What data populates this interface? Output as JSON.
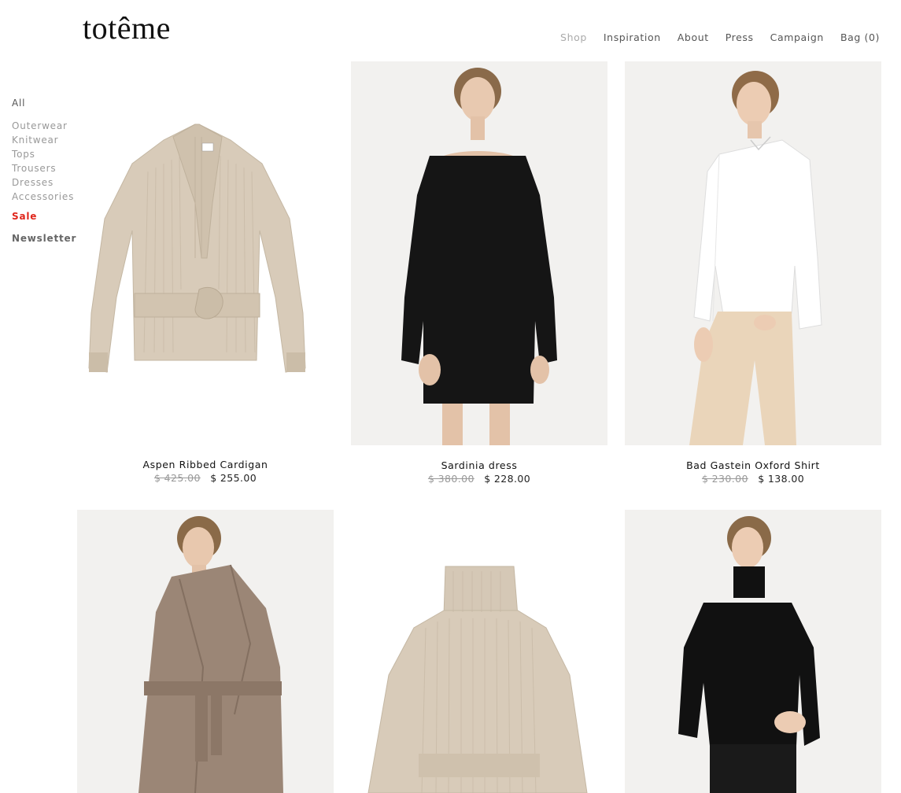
{
  "logo": "totême",
  "nav": {
    "items": [
      {
        "label": "Shop",
        "active": true
      },
      {
        "label": "Inspiration",
        "active": false
      },
      {
        "label": "About",
        "active": false
      },
      {
        "label": "Press",
        "active": false
      },
      {
        "label": "Campaign",
        "active": false
      },
      {
        "label": "Bag (0)",
        "active": false
      }
    ]
  },
  "sidebar": {
    "all": "All",
    "categories": [
      "Outerwear",
      "Knitwear",
      "Tops",
      "Trousers",
      "Dresses",
      "Accessories"
    ],
    "sale": "Sale",
    "newsletter": "Newsletter",
    "sale_color": "#e0261c"
  },
  "products": [
    {
      "name": "Aspen Ribbed Cardigan",
      "old_price": "$ 425.00",
      "price": "$ 255.00",
      "image": "beige-cardigan"
    },
    {
      "name": "Sardinia dress",
      "old_price": "$ 380.00",
      "price": "$ 228.00",
      "image": "black-dress-model"
    },
    {
      "name": "Bad Gastein Oxford Shirt",
      "old_price": "$ 230.00",
      "price": "$ 138.00",
      "image": "white-shirt-model"
    },
    {
      "name": "",
      "old_price": "",
      "price": "",
      "image": "taupe-wrap-coat-model"
    },
    {
      "name": "",
      "old_price": "",
      "price": "",
      "image": "beige-turtleneck-sweater"
    },
    {
      "name": "",
      "old_price": "",
      "price": "",
      "image": "black-turtleneck-model"
    }
  ]
}
